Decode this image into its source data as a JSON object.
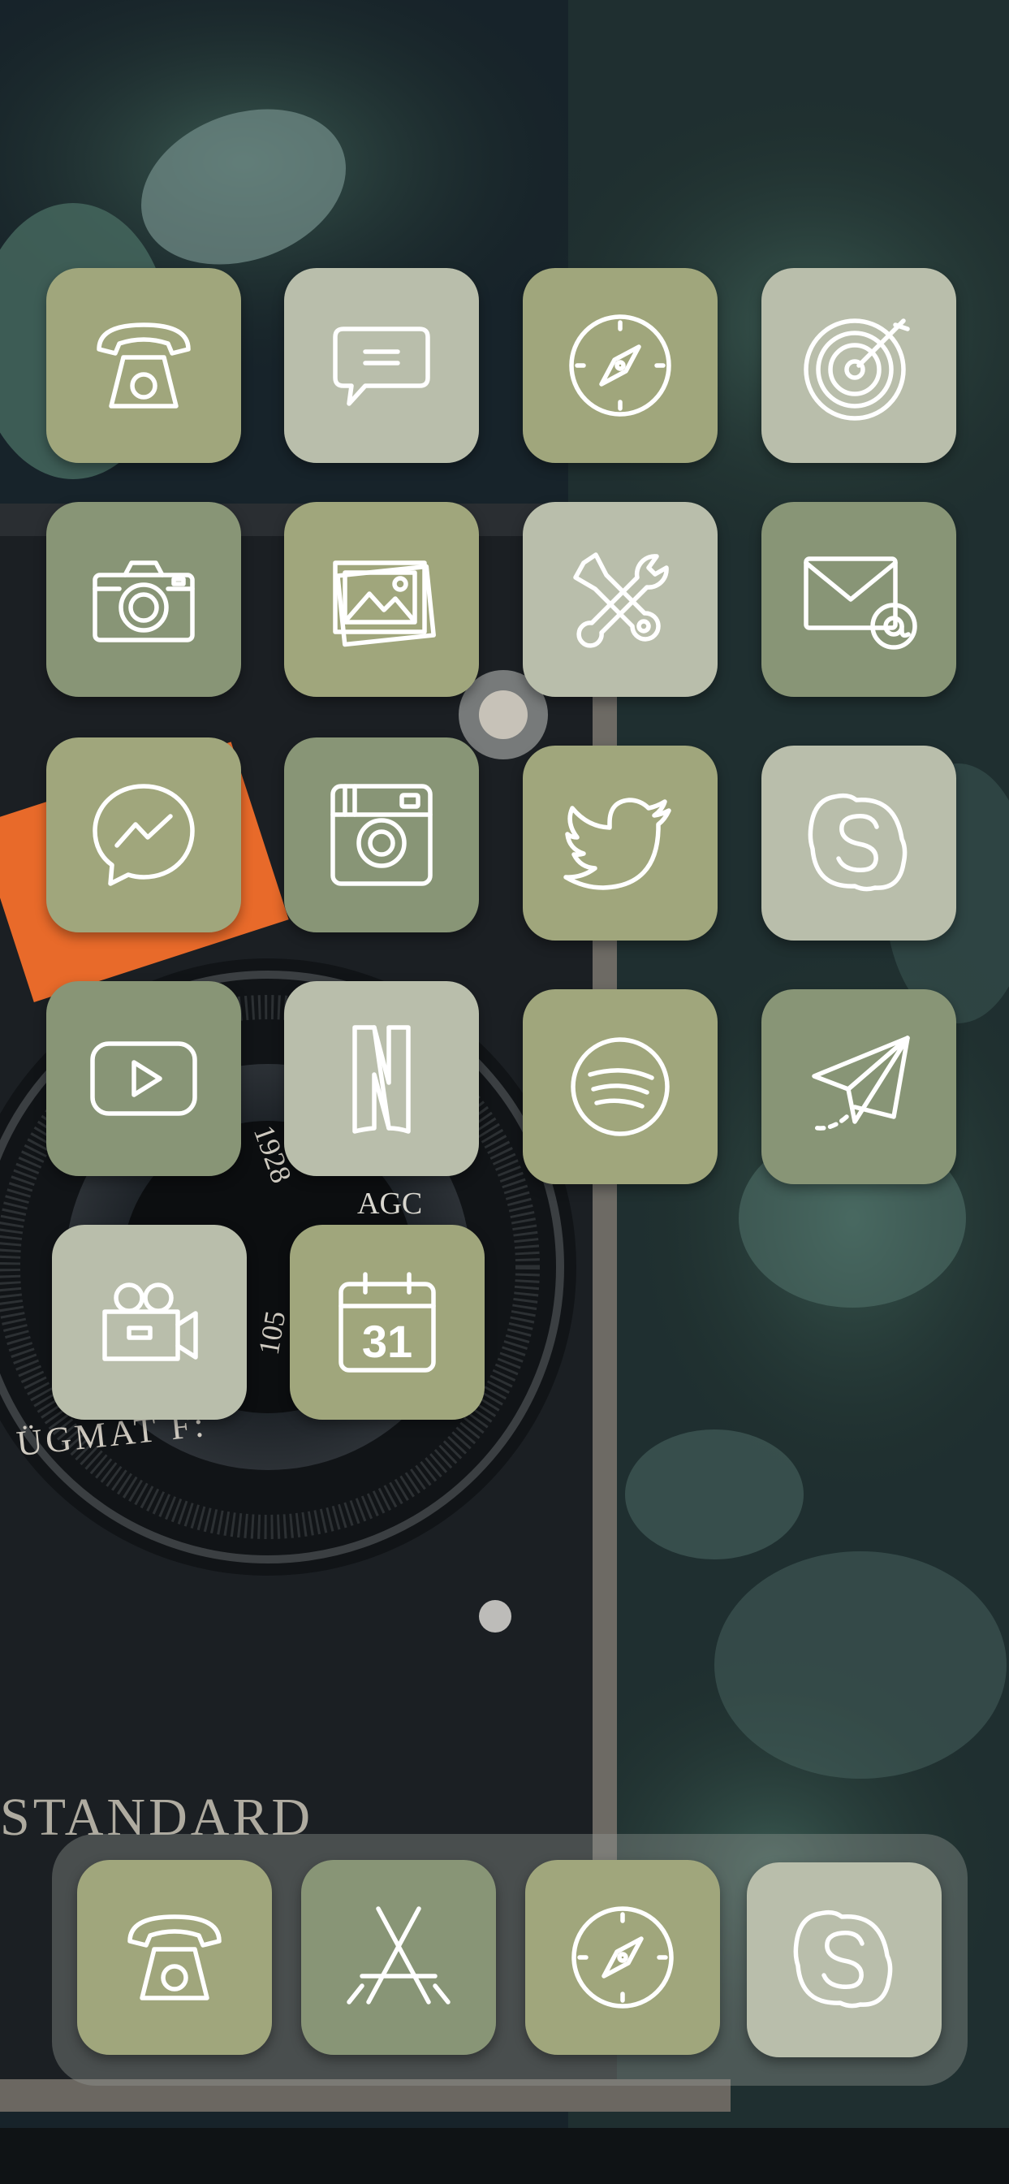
{
  "wallpaper": {
    "subject": "vintage-camera-with-eucalyptus"
  },
  "wallpaper_text": {
    "lens_brand": "AGC",
    "lens_model": "ÜGMAT F:",
    "lens_year": "1928",
    "lens_focal": "105",
    "camera_plate": "STANDARD"
  },
  "colors": {
    "olive": "#a0a67c",
    "sage_gray": "#b9beab",
    "dark_olive": "#889576",
    "mid_olive": "#95a07c"
  },
  "home_icons": [
    {
      "name": "phone",
      "icon": "rotary-phone-icon",
      "color": "#a0a67c"
    },
    {
      "name": "messages",
      "icon": "chat-bubble-icon",
      "color": "#b9beab"
    },
    {
      "name": "safari",
      "icon": "compass-icon",
      "color": "#a0a67c"
    },
    {
      "name": "music",
      "icon": "vinyl-record-icon",
      "color": "#b9beab"
    },
    {
      "name": "camera",
      "icon": "camera-icon",
      "color": "#889576"
    },
    {
      "name": "photos",
      "icon": "photos-icon",
      "color": "#a0a67c"
    },
    {
      "name": "settings",
      "icon": "tools-icon",
      "color": "#b9beab"
    },
    {
      "name": "mail",
      "icon": "mail-icon",
      "color": "#889576"
    },
    {
      "name": "messenger",
      "icon": "messenger-icon",
      "color": "#a0a67c"
    },
    {
      "name": "instagram",
      "icon": "instagram-icon",
      "color": "#889576"
    },
    {
      "name": "twitter",
      "icon": "twitter-bird-icon",
      "color": "#a0a67c"
    },
    {
      "name": "skype",
      "icon": "skype-icon",
      "color": "#b9beab"
    },
    {
      "name": "youtube",
      "icon": "youtube-play-icon",
      "color": "#889576"
    },
    {
      "name": "netflix",
      "icon": "netflix-icon",
      "color": "#b9beab"
    },
    {
      "name": "spotify",
      "icon": "spotify-icon",
      "color": "#a0a67c"
    },
    {
      "name": "telegram",
      "icon": "paper-plane-icon",
      "color": "#889576"
    },
    {
      "name": "videos",
      "icon": "movie-camera-icon",
      "color": "#b9beab"
    },
    {
      "name": "calendar",
      "icon": "calendar-icon",
      "color": "#a0a67c",
      "day": "31"
    }
  ],
  "dock_icons": [
    {
      "name": "phone",
      "icon": "rotary-phone-icon",
      "color": "#a0a67c"
    },
    {
      "name": "app-store",
      "icon": "app-store-icon",
      "color": "#889576"
    },
    {
      "name": "safari",
      "icon": "compass-icon",
      "color": "#a0a67c"
    },
    {
      "name": "skype",
      "icon": "skype-icon",
      "color": "#b9beab"
    }
  ]
}
